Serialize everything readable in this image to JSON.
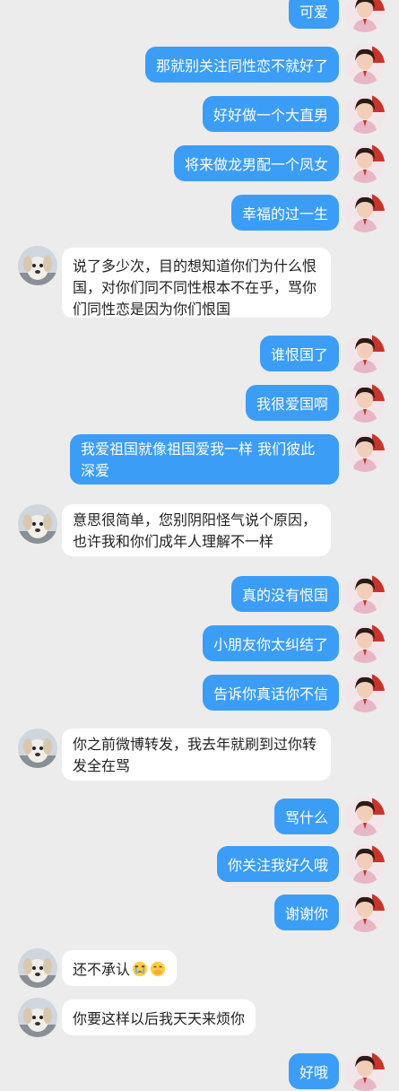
{
  "colors": {
    "background": "#ececec",
    "sent_bubble": "#3b9df6",
    "received_bubble": "#ffffff",
    "sent_text": "#ffffff",
    "received_text": "#222222"
  },
  "messages": [
    {
      "side": "right",
      "text": "可爱",
      "avatar": "woman-avatar-icon"
    },
    {
      "side": "right",
      "text": "那就别关注同性恋不就好了",
      "avatar": "woman-avatar-icon"
    },
    {
      "side": "right",
      "text": "好好做一个大直男",
      "avatar": "woman-avatar-icon"
    },
    {
      "side": "right",
      "text": "将来做龙男配一个凤女",
      "avatar": "woman-avatar-icon"
    },
    {
      "side": "right",
      "text": "幸福的过一生",
      "avatar": "woman-avatar-icon"
    },
    {
      "side": "left",
      "text": "说了多少次，目的想知道你们为什么恨国，对你们同不同性根本不在乎，骂你们同性恋是因为你们恨国",
      "avatar": "puppy-avatar-icon"
    },
    {
      "side": "right",
      "text": "谁恨国了",
      "avatar": "woman-avatar-icon"
    },
    {
      "side": "right",
      "text": "我很爱国啊",
      "avatar": "woman-avatar-icon"
    },
    {
      "side": "right",
      "text": "我爱祖国就像祖国爱我一样 我们彼此深爱",
      "avatar": "woman-avatar-icon"
    },
    {
      "side": "left",
      "text": "意思很简单，您别阴阳怪气说个原因，也许我和你们成年人理解不一样",
      "avatar": "puppy-avatar-icon"
    },
    {
      "side": "right",
      "text": "真的没有恨国",
      "avatar": "woman-avatar-icon"
    },
    {
      "side": "right",
      "text": "小朋友你太纠结了",
      "avatar": "woman-avatar-icon"
    },
    {
      "side": "right",
      "text": "告诉你真话你不信",
      "avatar": "woman-avatar-icon"
    },
    {
      "side": "left",
      "text": "你之前微博转发，我去年就刷到过你转发全在骂",
      "avatar": "puppy-avatar-icon"
    },
    {
      "side": "right",
      "text": "骂什么",
      "avatar": "woman-avatar-icon"
    },
    {
      "side": "right",
      "text": "你关注我好久哦",
      "avatar": "woman-avatar-icon"
    },
    {
      "side": "right",
      "text": "谢谢你",
      "avatar": "woman-avatar-icon"
    },
    {
      "side": "left",
      "text": "还不承认",
      "emojis": [
        "crying-face-icon",
        "hand-over-mouth-face-icon"
      ],
      "avatar": "puppy-avatar-icon"
    },
    {
      "side": "left",
      "text": "你要这样以后我天天来烦你",
      "avatar": "puppy-avatar-icon"
    },
    {
      "side": "right",
      "text": "好哦",
      "avatar": "woman-avatar-icon"
    }
  ]
}
